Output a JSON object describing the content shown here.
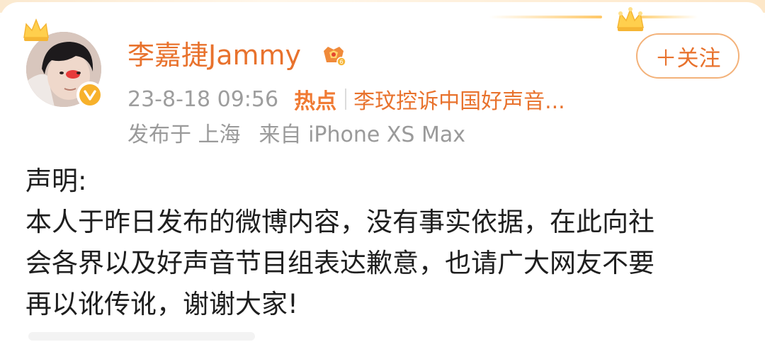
{
  "post": {
    "author": {
      "name": "李嘉捷Jammy",
      "avatar_icon": "avatar-photo",
      "verified_icon": "verified-v-icon",
      "member_icon": "vip-crown-icon"
    },
    "follow_button": {
      "label": "＋关注"
    },
    "meta": {
      "time": "23-8-18 09:56",
      "hot_label": "热点",
      "topic": "李玟控诉中国好声音..."
    },
    "source": {
      "location": "发布于 上海",
      "device": "来自 iPhone XS Max"
    },
    "body": {
      "lines": [
        "声明:",
        "本人于昨日发布的微博内容，没有事实依据，在此向社",
        "会各界以及好声音节目组表达歉意，也请广大网友不要",
        "再以讹传讹，谢谢大家!"
      ]
    }
  },
  "colors": {
    "accent": "#e8722d",
    "meta_gray": "#9a9a9a",
    "text": "#1e1e1e",
    "badge": "#f7b12b"
  }
}
